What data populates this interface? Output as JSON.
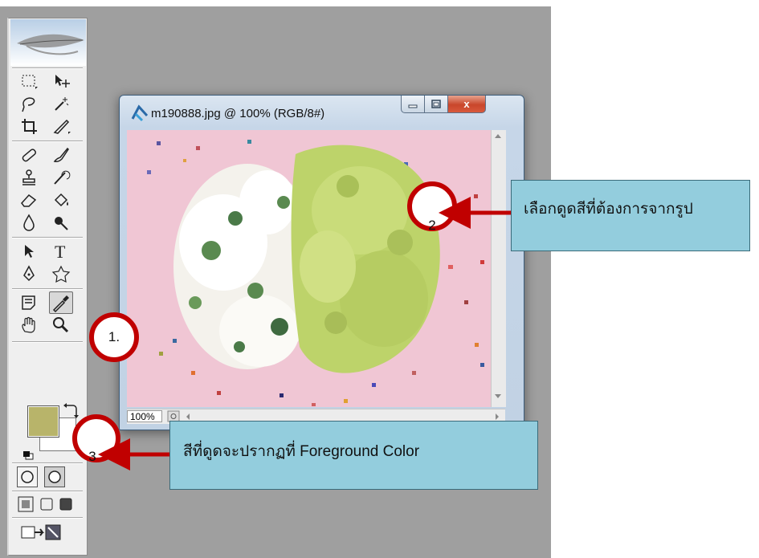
{
  "document": {
    "title": "m190888.jpg @ 100% (RGB/8#)",
    "zoom": "100%",
    "min_label": "▭",
    "max_label": "▢",
    "close_label": "x"
  },
  "toolbox": {
    "foreground_color": "#b8b46a",
    "background_color": "#ffffff"
  },
  "annotations": {
    "step1": "1.",
    "step2": "2",
    "step3": "3",
    "callout2": "เลือกดูดสีที่ต้องการจากรูป",
    "callout3": "สีที่ดูดจะปรากฏที่ Foreground Color"
  },
  "colors": {
    "annotation_red": "#c00000",
    "callout_fill": "#93cddd",
    "canvas_pink": "#f0c6d4"
  },
  "icons": [
    "feather-icon",
    "marquee-icon",
    "move-icon",
    "lasso-icon",
    "magic-wand-icon",
    "crop-icon",
    "slice-icon",
    "healing-brush-icon",
    "brush-icon",
    "stamp-icon",
    "history-brush-icon",
    "eraser-icon",
    "paint-bucket-icon",
    "blur-icon",
    "dodge-icon",
    "path-select-icon",
    "type-icon",
    "pen-icon",
    "shape-icon",
    "notes-icon",
    "eyedropper-icon",
    "hand-icon",
    "zoom-icon",
    "swap-colors-icon",
    "default-colors-icon",
    "standard-mode-icon",
    "quickmask-icon",
    "screen-mode-icon",
    "jump-to-imageready-icon"
  ]
}
